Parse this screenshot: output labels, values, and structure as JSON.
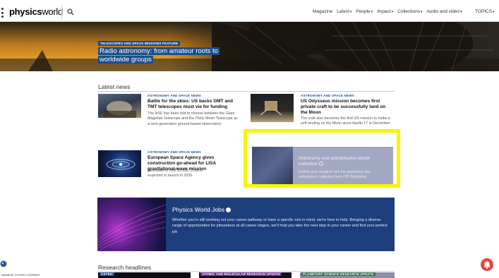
{
  "nav": {
    "logo_bold": "physics",
    "logo_thin": "world",
    "menu": [
      {
        "label": "Magazine",
        "has_caret": false
      },
      {
        "label": "Latest",
        "has_caret": true
      },
      {
        "label": "People",
        "has_caret": true
      },
      {
        "label": "Impact",
        "has_caret": true
      },
      {
        "label": "Collections",
        "has_caret": true
      },
      {
        "label": "Audio and video",
        "has_caret": true
      }
    ],
    "topics": "TOPICS",
    "caret": "▾"
  },
  "hero": {
    "tag": "TELESCOPES AND SPACE MISSIONS   FEATURE",
    "title": "Radio astronomy: from amateur roots to worldwide groups"
  },
  "latest": {
    "title": "Latest news",
    "articles": [
      {
        "tag": "ASTRONOMY AND SPACE   NEWS",
        "headline": "Battle for the skies: US backs GMT and TMT telescopes must vie for funding",
        "summary": "The NSF has been told to choose between the Giant Magellan Telescope and the Thirty Meter Telescope as a next-generation ground-based observatory"
      },
      {
        "tag": "ASTRONOMY AND SPACE   NEWS",
        "headline": "US Odysseus mission becomes first private craft to be successfully land on the Moon",
        "summary": "The craft also becomes the first US mission to make a soft landing on the Moon since Apollo 17 in December 1972"
      },
      {
        "tag": "ASTRONOMY AND SPACE   NEWS",
        "headline": "European Space Agency gives construction go-ahead for LISA gravitational-wave mission",
        "summary": "Estimated to cost €1.5bn, LISA is expected to launch in 2035"
      }
    ],
    "promo": {
      "title": "Astronomy and astrophysics ebook collection",
      "text": "Further your research with the astronomy and astrophysics collection from IOP Publishing"
    }
  },
  "jobs": {
    "title": "Physics World Jobs",
    "text": "Whether you're still working out your career pathway or have a specific role in mind, we're here to help. Bringing a diverse range of opportunities for jobseekers at all career stages, we'll help you take the next step in your career and find your perfect job"
  },
  "research": {
    "title": "Research headlines",
    "tags": [
      "ASTRO",
      "ATOMIC AND MOLECULAR   RESEARCH UPDATE",
      "PLANETARY SCIENCE   RESEARCH UPDATE"
    ]
  },
  "footer": {
    "cookie_label": "MANAGE COOKIE CONSENT"
  },
  "colors": {
    "brand_blue": "#1b4f8a",
    "highlight": "#f6f600",
    "jobs_bg": "#1d3d7c",
    "help_red": "#e5463d"
  }
}
